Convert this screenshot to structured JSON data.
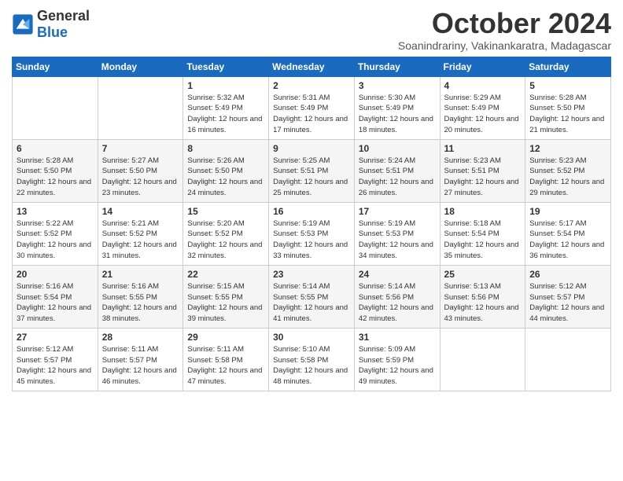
{
  "logo": {
    "general": "General",
    "blue": "Blue"
  },
  "title": "October 2024",
  "subtitle": "Soanindrariny, Vakinankaratra, Madagascar",
  "days_of_week": [
    "Sunday",
    "Monday",
    "Tuesday",
    "Wednesday",
    "Thursday",
    "Friday",
    "Saturday"
  ],
  "weeks": [
    [
      {
        "day": "",
        "info": ""
      },
      {
        "day": "",
        "info": ""
      },
      {
        "day": "1",
        "info": "Sunrise: 5:32 AM\nSunset: 5:49 PM\nDaylight: 12 hours and 16 minutes."
      },
      {
        "day": "2",
        "info": "Sunrise: 5:31 AM\nSunset: 5:49 PM\nDaylight: 12 hours and 17 minutes."
      },
      {
        "day": "3",
        "info": "Sunrise: 5:30 AM\nSunset: 5:49 PM\nDaylight: 12 hours and 18 minutes."
      },
      {
        "day": "4",
        "info": "Sunrise: 5:29 AM\nSunset: 5:49 PM\nDaylight: 12 hours and 20 minutes."
      },
      {
        "day": "5",
        "info": "Sunrise: 5:28 AM\nSunset: 5:50 PM\nDaylight: 12 hours and 21 minutes."
      }
    ],
    [
      {
        "day": "6",
        "info": "Sunrise: 5:28 AM\nSunset: 5:50 PM\nDaylight: 12 hours and 22 minutes."
      },
      {
        "day": "7",
        "info": "Sunrise: 5:27 AM\nSunset: 5:50 PM\nDaylight: 12 hours and 23 minutes."
      },
      {
        "day": "8",
        "info": "Sunrise: 5:26 AM\nSunset: 5:50 PM\nDaylight: 12 hours and 24 minutes."
      },
      {
        "day": "9",
        "info": "Sunrise: 5:25 AM\nSunset: 5:51 PM\nDaylight: 12 hours and 25 minutes."
      },
      {
        "day": "10",
        "info": "Sunrise: 5:24 AM\nSunset: 5:51 PM\nDaylight: 12 hours and 26 minutes."
      },
      {
        "day": "11",
        "info": "Sunrise: 5:23 AM\nSunset: 5:51 PM\nDaylight: 12 hours and 27 minutes."
      },
      {
        "day": "12",
        "info": "Sunrise: 5:23 AM\nSunset: 5:52 PM\nDaylight: 12 hours and 29 minutes."
      }
    ],
    [
      {
        "day": "13",
        "info": "Sunrise: 5:22 AM\nSunset: 5:52 PM\nDaylight: 12 hours and 30 minutes."
      },
      {
        "day": "14",
        "info": "Sunrise: 5:21 AM\nSunset: 5:52 PM\nDaylight: 12 hours and 31 minutes."
      },
      {
        "day": "15",
        "info": "Sunrise: 5:20 AM\nSunset: 5:52 PM\nDaylight: 12 hours and 32 minutes."
      },
      {
        "day": "16",
        "info": "Sunrise: 5:19 AM\nSunset: 5:53 PM\nDaylight: 12 hours and 33 minutes."
      },
      {
        "day": "17",
        "info": "Sunrise: 5:19 AM\nSunset: 5:53 PM\nDaylight: 12 hours and 34 minutes."
      },
      {
        "day": "18",
        "info": "Sunrise: 5:18 AM\nSunset: 5:54 PM\nDaylight: 12 hours and 35 minutes."
      },
      {
        "day": "19",
        "info": "Sunrise: 5:17 AM\nSunset: 5:54 PM\nDaylight: 12 hours and 36 minutes."
      }
    ],
    [
      {
        "day": "20",
        "info": "Sunrise: 5:16 AM\nSunset: 5:54 PM\nDaylight: 12 hours and 37 minutes."
      },
      {
        "day": "21",
        "info": "Sunrise: 5:16 AM\nSunset: 5:55 PM\nDaylight: 12 hours and 38 minutes."
      },
      {
        "day": "22",
        "info": "Sunrise: 5:15 AM\nSunset: 5:55 PM\nDaylight: 12 hours and 39 minutes."
      },
      {
        "day": "23",
        "info": "Sunrise: 5:14 AM\nSunset: 5:55 PM\nDaylight: 12 hours and 41 minutes."
      },
      {
        "day": "24",
        "info": "Sunrise: 5:14 AM\nSunset: 5:56 PM\nDaylight: 12 hours and 42 minutes."
      },
      {
        "day": "25",
        "info": "Sunrise: 5:13 AM\nSunset: 5:56 PM\nDaylight: 12 hours and 43 minutes."
      },
      {
        "day": "26",
        "info": "Sunrise: 5:12 AM\nSunset: 5:57 PM\nDaylight: 12 hours and 44 minutes."
      }
    ],
    [
      {
        "day": "27",
        "info": "Sunrise: 5:12 AM\nSunset: 5:57 PM\nDaylight: 12 hours and 45 minutes."
      },
      {
        "day": "28",
        "info": "Sunrise: 5:11 AM\nSunset: 5:57 PM\nDaylight: 12 hours and 46 minutes."
      },
      {
        "day": "29",
        "info": "Sunrise: 5:11 AM\nSunset: 5:58 PM\nDaylight: 12 hours and 47 minutes."
      },
      {
        "day": "30",
        "info": "Sunrise: 5:10 AM\nSunset: 5:58 PM\nDaylight: 12 hours and 48 minutes."
      },
      {
        "day": "31",
        "info": "Sunrise: 5:09 AM\nSunset: 5:59 PM\nDaylight: 12 hours and 49 minutes."
      },
      {
        "day": "",
        "info": ""
      },
      {
        "day": "",
        "info": ""
      }
    ]
  ]
}
